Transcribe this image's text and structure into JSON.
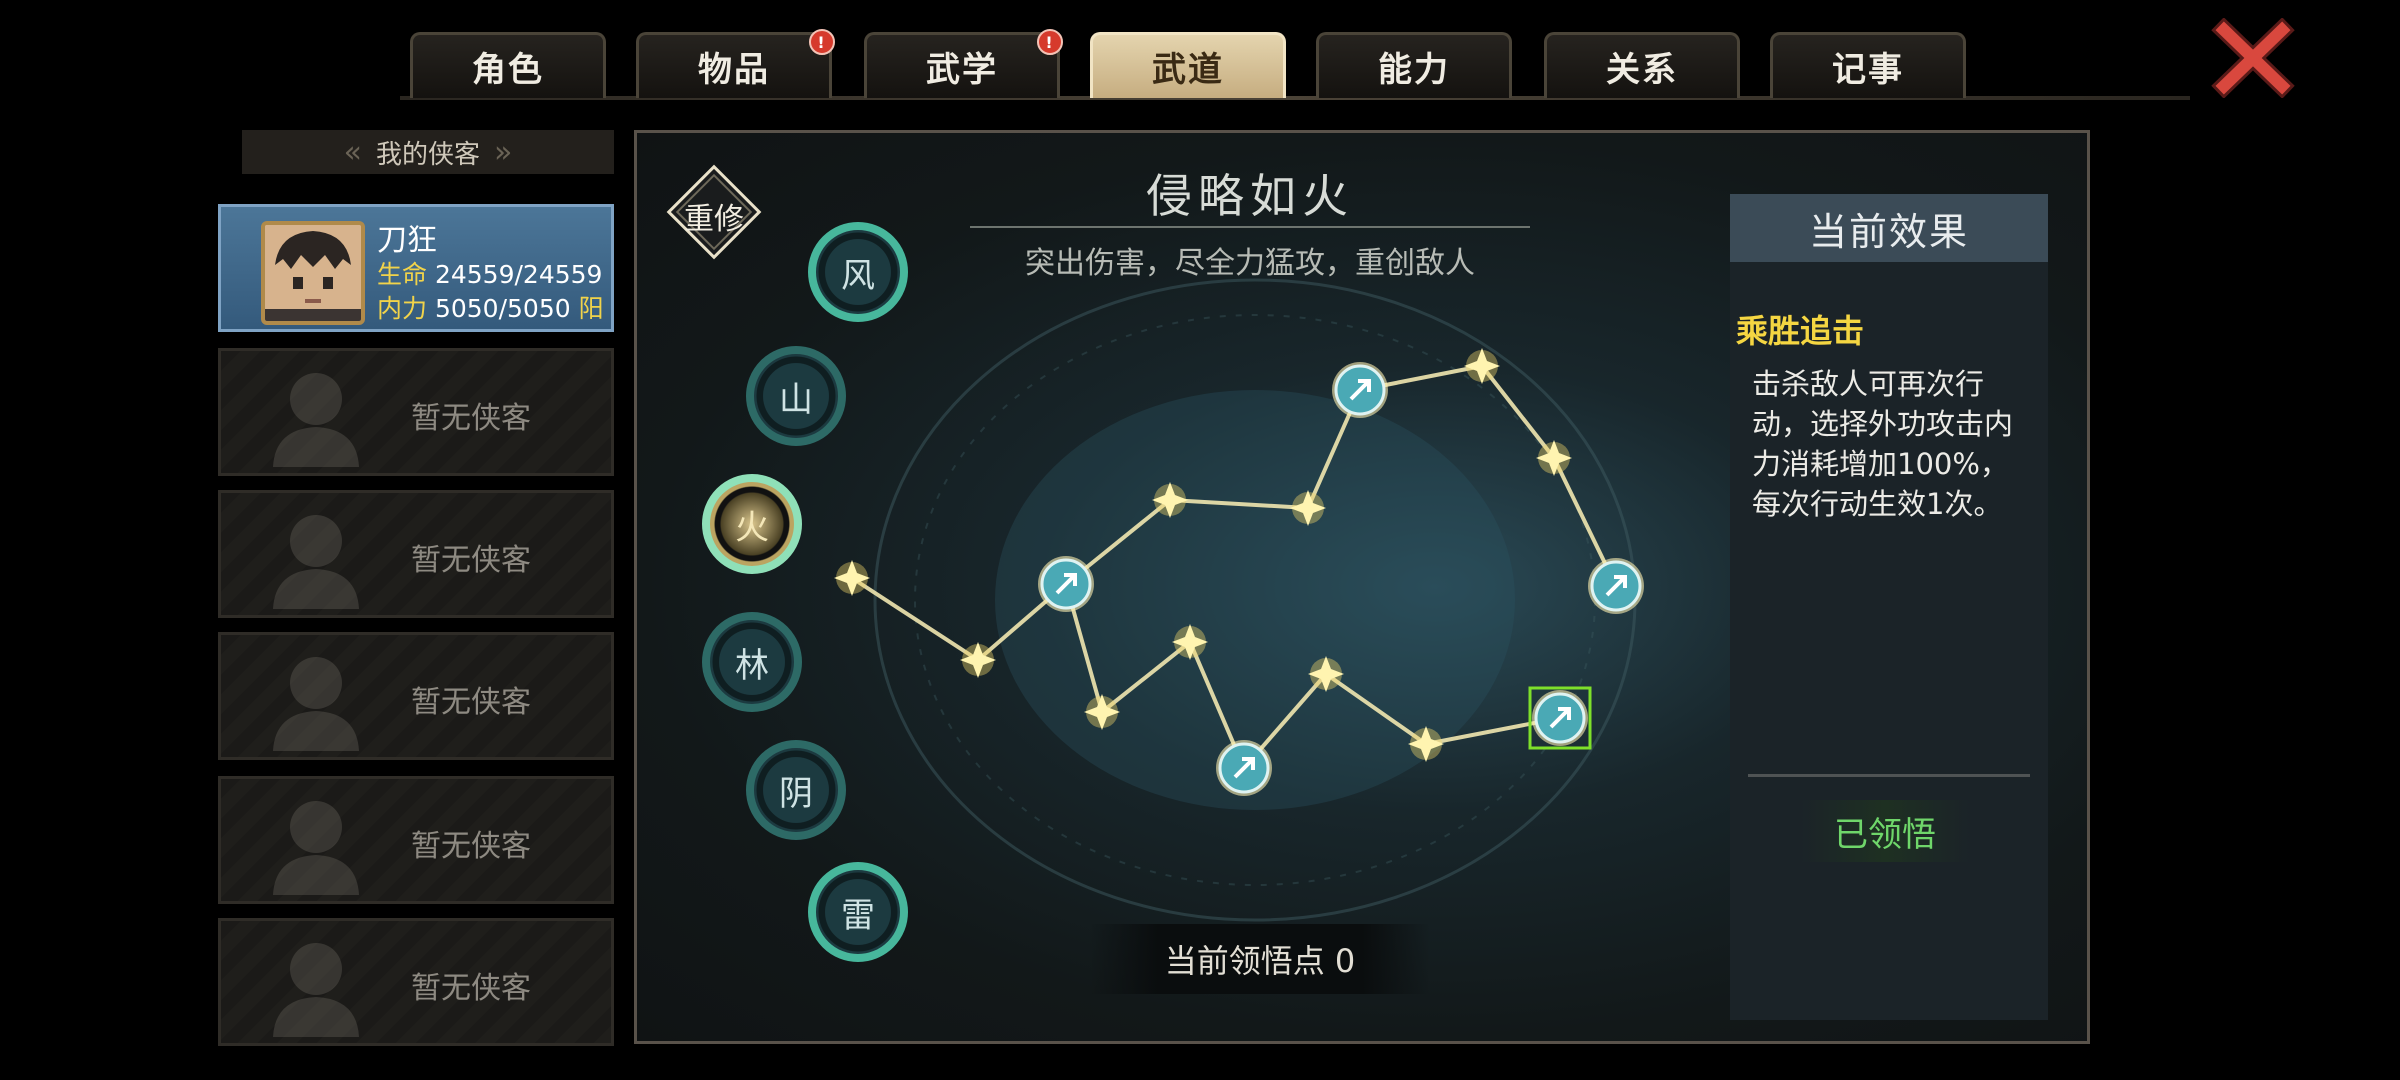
{
  "tabs": [
    {
      "label": "角色",
      "badge": ""
    },
    {
      "label": "物品",
      "badge": "!"
    },
    {
      "label": "武学",
      "badge": "!"
    },
    {
      "label": "武道",
      "badge": ""
    },
    {
      "label": "能力",
      "badge": ""
    },
    {
      "label": "关系",
      "badge": ""
    },
    {
      "label": "记事",
      "badge": ""
    }
  ],
  "active_tab": "武道",
  "heroes": {
    "header": "我的侠客",
    "selected": {
      "name": "刀狂",
      "hp_label": "生命",
      "hp_value": "24559/24559",
      "mp_label": "内力",
      "mp_value": "5050/5050",
      "tag": "阳"
    },
    "empty_slots": [
      "暂无侠客",
      "暂无侠客",
      "暂无侠客",
      "暂无侠客",
      "暂无侠客"
    ]
  },
  "path": {
    "reset_label": "重修",
    "title": "侵略如火",
    "subtitle": "突出伤害，尽全力猛攻，重创敌人",
    "elements": [
      {
        "label": "风",
        "state": "ringbright"
      },
      {
        "label": "山",
        "state": "ring"
      },
      {
        "label": "火",
        "state": "active"
      },
      {
        "label": "林",
        "state": "ring"
      },
      {
        "label": "阴",
        "state": "ring"
      },
      {
        "label": "雷",
        "state": "ringbright"
      }
    ],
    "points_text": "当前领悟点 0"
  },
  "effect": {
    "header": "当前效果",
    "name": "乘胜追击",
    "description": "击杀敌人可再次行动，选择外功攻击内力消耗增加100%，每次行动生效1次。",
    "status": "已领悟"
  },
  "colors": {
    "accent_gold": "#f5d642",
    "status_green": "#6fd66a",
    "badge_red": "#d63a2c",
    "node_teal": "#4aa9b5",
    "star_glow": "#fff4b0"
  }
}
